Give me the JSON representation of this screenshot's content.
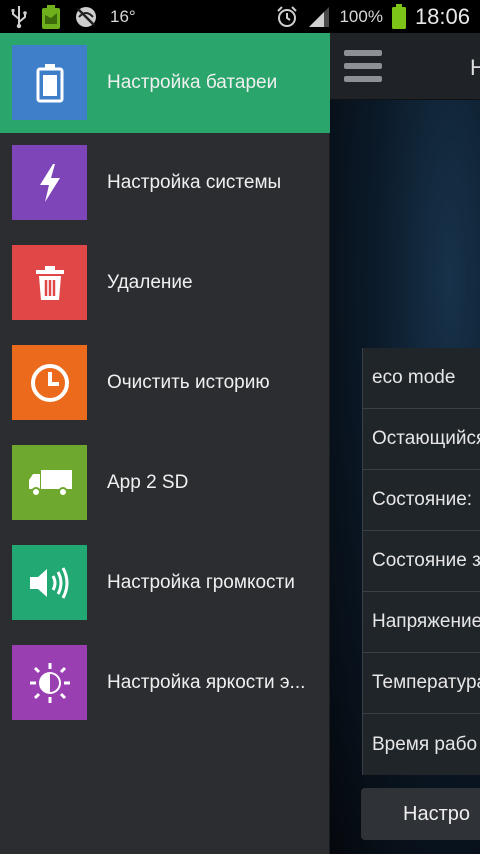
{
  "status_bar": {
    "temperature": "16°",
    "battery_percent": "100%",
    "time": "18:06",
    "icons": [
      "usb-icon",
      "battery-saver-icon",
      "no-signal-icon",
      "alarm-icon",
      "signal-icon",
      "battery-icon"
    ]
  },
  "app": {
    "title": "Н",
    "info_rows": [
      "eco mode",
      "Остающийся",
      "Состояние:",
      "Состояние з",
      "Напряжение",
      "Температура",
      "Время рабо"
    ],
    "bottom_button": "Настро"
  },
  "drawer": {
    "items": [
      {
        "label": "Настройка батареи",
        "icon": "battery-icon",
        "color": "#3f7ec8"
      },
      {
        "label": "Настройка системы",
        "icon": "lightning-icon",
        "color": "#7d45b8"
      },
      {
        "label": "Удаление",
        "icon": "trash-icon",
        "color": "#e04848"
      },
      {
        "label": "Очистить историю",
        "icon": "clock-icon",
        "color": "#ec6a1c"
      },
      {
        "label": "App 2 SD",
        "icon": "truck-icon",
        "color": "#6ea82f"
      },
      {
        "label": "Настройка громкости",
        "icon": "speaker-icon",
        "color": "#21a873"
      },
      {
        "label": "Настройка яркости э...",
        "icon": "brightness-icon",
        "color": "#9a3fb1"
      }
    ],
    "active_index": 0,
    "active_color": "#2aa56b"
  }
}
